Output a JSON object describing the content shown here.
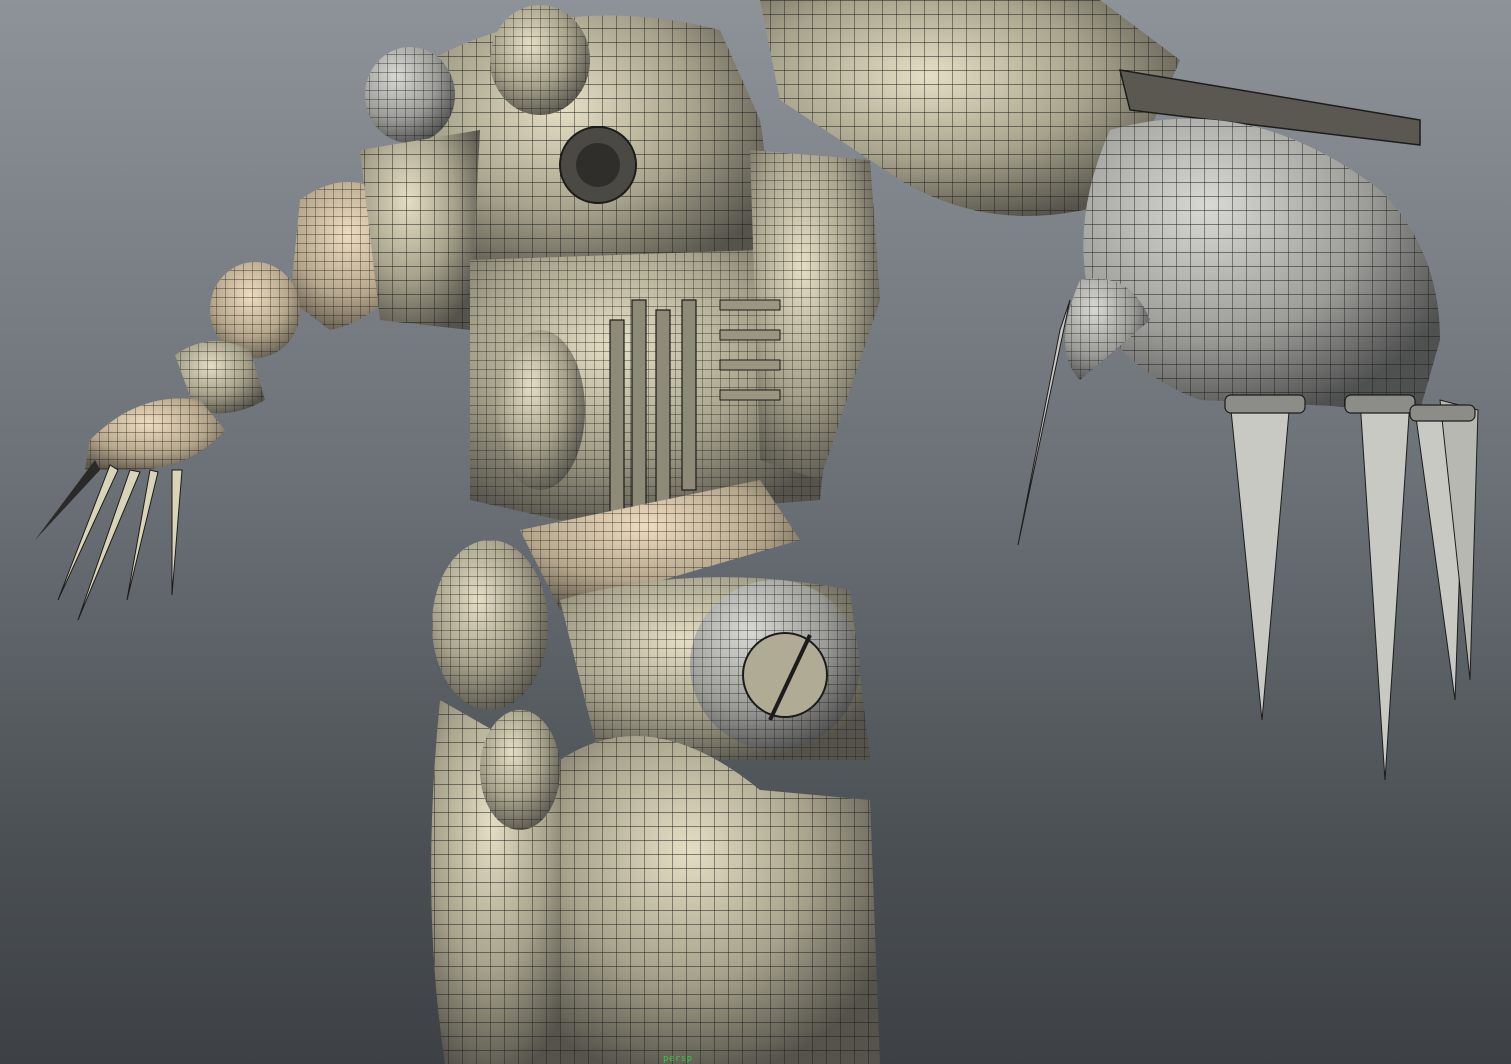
{
  "viewport": {
    "camera_label": "persp",
    "background_top": "#8d9399",
    "background_bottom": "#3d4145",
    "model": {
      "description_name": "mechanical-creature-wireframe-on-shaded",
      "colors": {
        "shade_light": "#d9d4b8",
        "shade_mid": "#a8a38c",
        "shade_dark": "#5a5850",
        "wire": "#1c1c1a",
        "warm_highlight": "#e6cfb0"
      }
    }
  }
}
